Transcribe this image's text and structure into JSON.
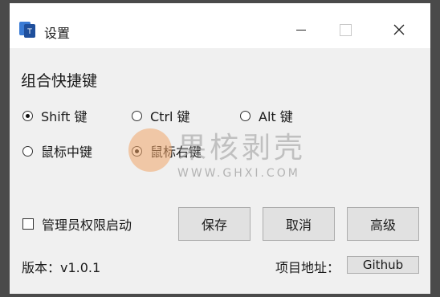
{
  "window": {
    "title": "设置",
    "controls": {
      "minimize": "minimize",
      "maximize": "maximize",
      "close": "close"
    }
  },
  "shortcut_section": {
    "title": "组合快捷键",
    "options": [
      {
        "label": "Shift 键",
        "checked": true
      },
      {
        "label": "Ctrl 键",
        "checked": false
      },
      {
        "label": "Alt 键",
        "checked": false
      },
      {
        "label": "鼠标中键",
        "checked": false
      },
      {
        "label": "鼠标右键",
        "checked": true
      }
    ]
  },
  "admin_checkbox": {
    "label": "管理员权限启动",
    "checked": false
  },
  "buttons": {
    "save": "保存",
    "cancel": "取消",
    "advanced": "高级"
  },
  "footer": {
    "version": "版本：v1.0.1",
    "project_address_label": "项目地址：",
    "github_button": "Github"
  },
  "watermark": {
    "text": "果核剥壳",
    "url": "WWW.GHXI.COM"
  },
  "colors": {
    "frame": "#4a4a4a",
    "window_bg": "#f0f0f0",
    "button_bg": "#e1e1e1",
    "watermark_orange": "#f0a56a"
  }
}
